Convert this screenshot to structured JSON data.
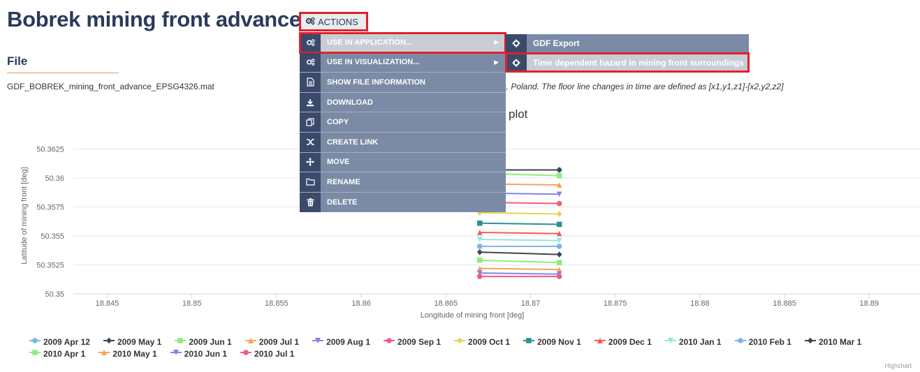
{
  "page": {
    "title": "Bobrek mining front advance",
    "actions_label": "ACTIONS",
    "section_title": "File",
    "file_name": "GDF_BOBREK_mining_front_advance_EPSG4326.mat",
    "description_visible": "e, Poland. The floor line changes in time are defined as [x1,y1,z1]-[x2,y2,z2]",
    "chart_title_visible": "plot",
    "credits": "Highchart"
  },
  "menu": {
    "items": [
      {
        "label": "USE IN APPLICATION...",
        "icon": "cogs-icon",
        "has_submenu": true,
        "state": "highlighted-outlined"
      },
      {
        "label": "USE IN VISUALIZATION...",
        "icon": "cogs-icon",
        "has_submenu": true,
        "state": "normal"
      },
      {
        "label": "SHOW FILE INFORMATION",
        "icon": "file-text-icon",
        "has_submenu": false,
        "state": "normal"
      },
      {
        "label": "DOWNLOAD",
        "icon": "download-icon",
        "has_submenu": false,
        "state": "normal"
      },
      {
        "label": "COPY",
        "icon": "copy-icon",
        "has_submenu": false,
        "state": "normal"
      },
      {
        "label": "CREATE LINK",
        "icon": "shuffle-icon",
        "has_submenu": false,
        "state": "normal"
      },
      {
        "label": "MOVE",
        "icon": "move-icon",
        "has_submenu": false,
        "state": "normal"
      },
      {
        "label": "RENAME",
        "icon": "folder-icon",
        "has_submenu": false,
        "state": "normal"
      },
      {
        "label": "DELETE",
        "icon": "trash-icon",
        "has_submenu": false,
        "state": "normal"
      }
    ],
    "submenu": [
      {
        "label": "GDF Export",
        "icon": "gear-icon",
        "state": "normal"
      },
      {
        "label": "Time dependent hazard in mining front surroundings",
        "icon": "gear-icon",
        "state": "highlighted-outlined"
      }
    ],
    "colors": {
      "menu_bg": "#7b8ba6",
      "icon_bg": "#3b4a6b",
      "highlight": "#c8cdd5",
      "outline": "#e3202b"
    }
  },
  "chart_data": {
    "type": "line",
    "title": "",
    "xlabel": "Longitude of mining front [deg]",
    "ylabel": "Latitude of mining front [deg]",
    "xlim": [
      18.843,
      18.893
    ],
    "ylim": [
      50.35,
      50.3635
    ],
    "xticks": [
      18.845,
      18.85,
      18.855,
      18.86,
      18.865,
      18.87,
      18.875,
      18.88,
      18.885,
      18.89
    ],
    "xtick_labels": [
      "18.845",
      "18.85",
      "18.855",
      "18.86",
      "18.865",
      "18.87",
      "18.875",
      "18.88",
      "18.885",
      "18.89"
    ],
    "yticks": [
      50.35,
      50.3525,
      50.355,
      50.3575,
      50.36,
      50.3625
    ],
    "ytick_labels": [
      "50.35",
      "50.3525",
      "50.355",
      "50.3575",
      "50.36",
      "50.3625"
    ],
    "grid": true,
    "legend_position": "bottom",
    "series": [
      {
        "name": "2009 Apr 12",
        "color": "#7cb5ec",
        "marker": "circle",
        "x": [
          18.867,
          18.8717
        ],
        "y": [
          50.3607,
          50.3607
        ]
      },
      {
        "name": "2009 May 1",
        "color": "#434348",
        "marker": "diamond",
        "x": [
          18.867,
          18.8717
        ],
        "y": [
          50.3607,
          50.3607
        ]
      },
      {
        "name": "2009 Jun 1",
        "color": "#90ed7d",
        "marker": "square",
        "x": [
          18.867,
          18.8717
        ],
        "y": [
          50.3604,
          50.3602
        ]
      },
      {
        "name": "2009 Jul 1",
        "color": "#f7a35c",
        "marker": "triangle",
        "x": [
          18.867,
          18.8717
        ],
        "y": [
          50.3595,
          50.3594
        ]
      },
      {
        "name": "2009 Aug 1",
        "color": "#8085e9",
        "marker": "triangle-down",
        "x": [
          18.867,
          18.8717
        ],
        "y": [
          50.3587,
          50.3586
        ]
      },
      {
        "name": "2009 Sep 1",
        "color": "#f15c80",
        "marker": "circle",
        "x": [
          18.867,
          18.8717
        ],
        "y": [
          50.3579,
          50.3578
        ]
      },
      {
        "name": "2009 Oct 1",
        "color": "#e4d354",
        "marker": "diamond",
        "x": [
          18.867,
          18.8717
        ],
        "y": [
          50.357,
          50.3569
        ]
      },
      {
        "name": "2009 Nov 1",
        "color": "#2b908f",
        "marker": "square",
        "x": [
          18.867,
          18.8717
        ],
        "y": [
          50.3561,
          50.356
        ]
      },
      {
        "name": "2009 Dec 1",
        "color": "#f45b5b",
        "marker": "triangle",
        "x": [
          18.867,
          18.8717
        ],
        "y": [
          50.3553,
          50.3552
        ]
      },
      {
        "name": "2010 Jan 1",
        "color": "#91e8e1",
        "marker": "triangle-down",
        "x": [
          18.867,
          18.8717
        ],
        "y": [
          50.3547,
          50.3546
        ]
      },
      {
        "name": "2010 Feb 1",
        "color": "#7cb5ec",
        "marker": "circle",
        "x": [
          18.867,
          18.8717
        ],
        "y": [
          50.3541,
          50.3541
        ]
      },
      {
        "name": "2010 Mar 1",
        "color": "#434348",
        "marker": "diamond",
        "x": [
          18.867,
          18.8717
        ],
        "y": [
          50.3536,
          50.3534
        ]
      },
      {
        "name": "2010 Apr 1",
        "color": "#90ed7d",
        "marker": "square",
        "x": [
          18.867,
          18.8717
        ],
        "y": [
          50.3529,
          50.3527
        ]
      },
      {
        "name": "2010 May 1",
        "color": "#f7a35c",
        "marker": "triangle",
        "x": [
          18.867,
          18.8717
        ],
        "y": [
          50.3522,
          50.3521
        ]
      },
      {
        "name": "2010 Jun 1",
        "color": "#8085e9",
        "marker": "triangle-down",
        "x": [
          18.867,
          18.8717
        ],
        "y": [
          50.3518,
          50.3517
        ]
      },
      {
        "name": "2010 Jul 1",
        "color": "#f15c80",
        "marker": "circle",
        "x": [
          18.867,
          18.8717
        ],
        "y": [
          50.3515,
          50.3515
        ]
      }
    ]
  }
}
